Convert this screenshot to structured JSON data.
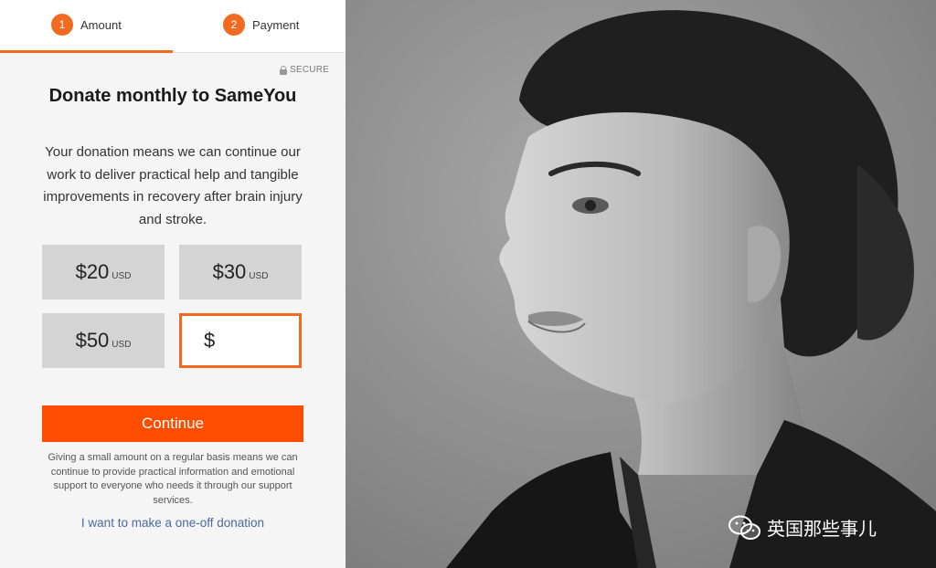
{
  "steps": [
    {
      "number": "1",
      "label": "Amount"
    },
    {
      "number": "2",
      "label": "Payment"
    }
  ],
  "secure_label": "SECURE",
  "title": "Donate monthly to SameYou",
  "description": "Your donation means we can continue our work to deliver practical help and tangible improvements in recovery after brain injury and stroke.",
  "amounts": [
    {
      "value": "$20",
      "currency": "USD"
    },
    {
      "value": "$30",
      "currency": "USD"
    },
    {
      "value": "$50",
      "currency": "USD"
    }
  ],
  "custom_amount": {
    "symbol": "$",
    "value": ""
  },
  "continue_label": "Continue",
  "note": "Giving a small amount on a regular basis means we can continue to provide practical information and emotional support to everyone who needs it through our support services.",
  "one_off_link": "I want to make a one-off donation",
  "watermark_text": "英国那些事儿",
  "colors": {
    "accent": "#f26a22",
    "button": "#ff4d00",
    "link": "#4a6aa0"
  }
}
